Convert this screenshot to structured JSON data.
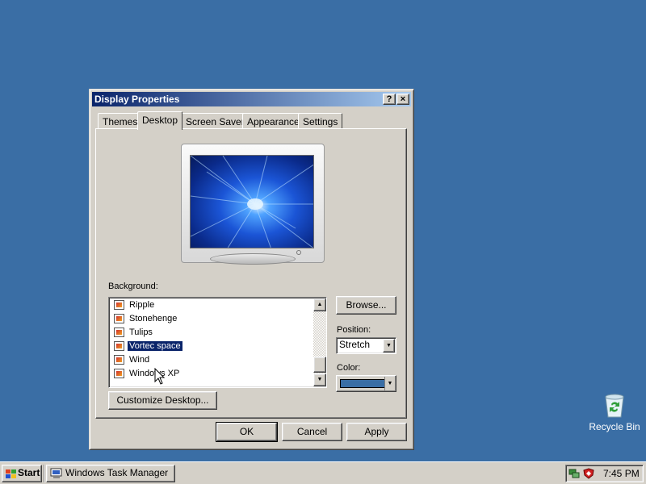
{
  "window": {
    "title": "Display Properties",
    "help_label": "?",
    "close_label": "×"
  },
  "tabs": [
    {
      "label": "Themes",
      "active": false
    },
    {
      "label": "Desktop",
      "active": true
    },
    {
      "label": "Screen Saver",
      "active": false
    },
    {
      "label": "Appearance",
      "active": false
    },
    {
      "label": "Settings",
      "active": false
    }
  ],
  "desktop": {
    "background_label": "Background:",
    "backgrounds": [
      {
        "name": "Ripple",
        "selected": false
      },
      {
        "name": "Stonehenge",
        "selected": false
      },
      {
        "name": "Tulips",
        "selected": false
      },
      {
        "name": "Vortec space",
        "selected": true
      },
      {
        "name": "Wind",
        "selected": false
      },
      {
        "name": "Windows XP",
        "selected": false
      }
    ],
    "browse_label": "Browse...",
    "position_label": "Position:",
    "position_value": "Stretch",
    "color_label": "Color:",
    "color_value": "#3a6ea5",
    "customize_label": "Customize Desktop..."
  },
  "buttons": {
    "ok": "OK",
    "cancel": "Cancel",
    "apply": "Apply"
  },
  "desktop_icons": {
    "recycle_bin": "Recycle Bin"
  },
  "taskbar": {
    "start_label": "Start",
    "task_label": "Windows Task Manager",
    "clock": "7:45 PM"
  }
}
